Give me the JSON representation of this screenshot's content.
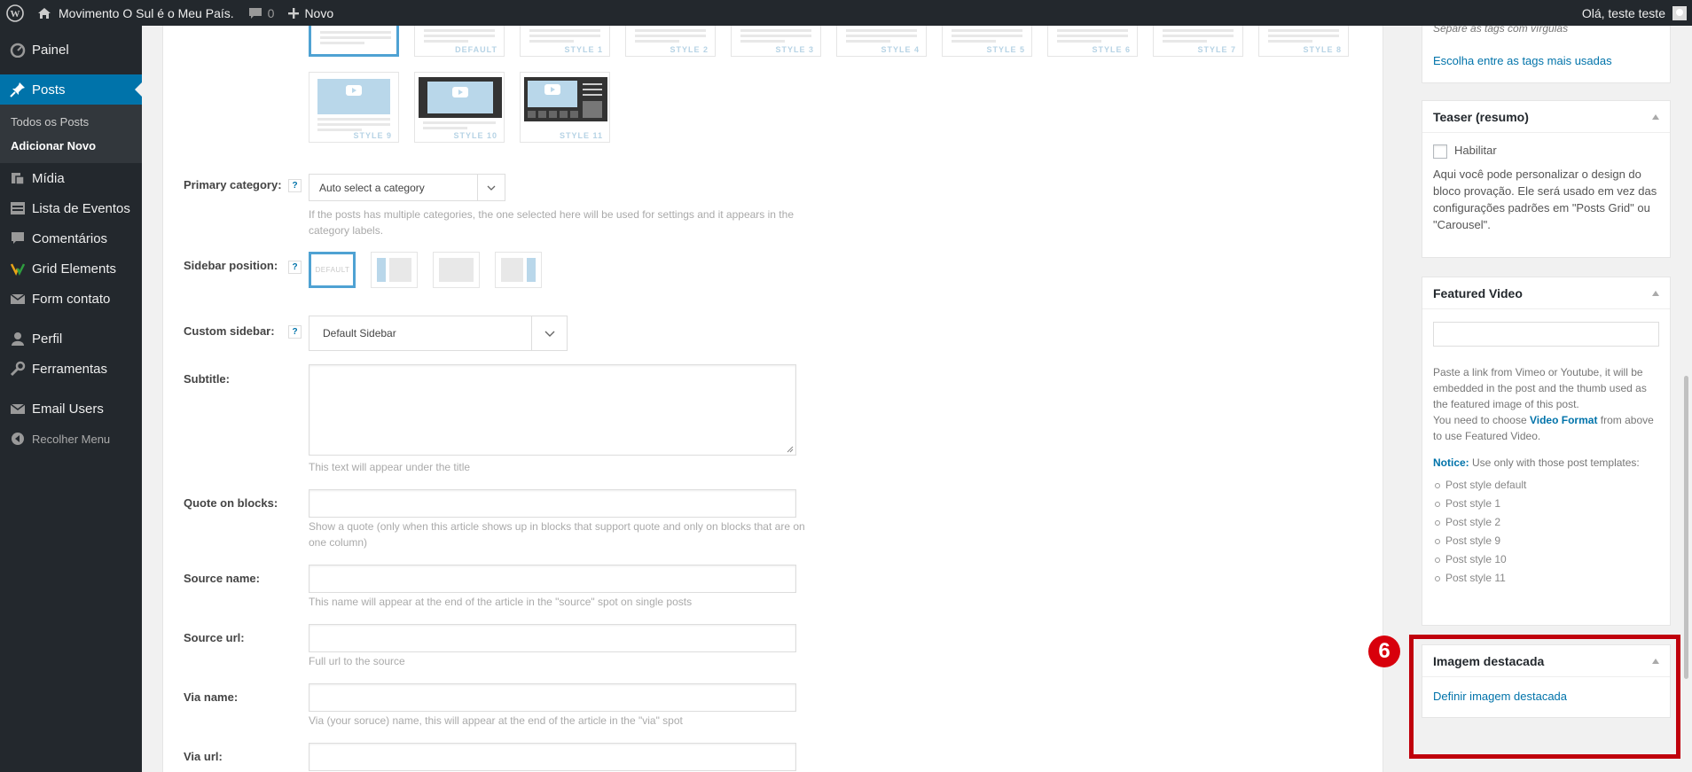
{
  "adminbar": {
    "site_name": "Movimento O Sul é o Meu País.",
    "comments_count": "0",
    "new_label": "Novo",
    "greeting": "Olá, teste teste"
  },
  "menu": {
    "painel": "Painel",
    "posts": "Posts",
    "sub_all": "Todos os Posts",
    "sub_new": "Adicionar Novo",
    "midia": "Mídia",
    "eventos": "Lista de Eventos",
    "comentarios": "Comentários",
    "grid": "Grid Elements",
    "form": "Form contato",
    "perfil": "Perfil",
    "ferramentas": "Ferramentas",
    "email": "Email Users",
    "recolher": "Recolher Menu"
  },
  "styles": {
    "row1": [
      "",
      "DEFAULT",
      "STYLE 1",
      "STYLE 2",
      "STYLE 3",
      "STYLE 4",
      "STYLE 5",
      "STYLE 6",
      "STYLE 7",
      "STYLE 8"
    ],
    "row2": [
      "STYLE 9",
      "STYLE 10",
      "STYLE 11"
    ]
  },
  "fields": {
    "primary_category": {
      "label": "Primary category:",
      "help": "?",
      "value": "Auto select a category",
      "desc": "If the posts has multiple categories, the one selected here will be used for settings and it appears in the category labels."
    },
    "sidebar_position": {
      "label": "Sidebar position:",
      "help": "?",
      "default_label": "DEFAULT"
    },
    "custom_sidebar": {
      "label": "Custom sidebar:",
      "help": "?",
      "value": "Default Sidebar"
    },
    "subtitle": {
      "label": "Subtitle:",
      "desc": "This text will appear under the title"
    },
    "quote": {
      "label": "Quote on blocks:",
      "desc": "Show a quote (only when this article shows up in blocks that support quote and only on blocks that are on one column)"
    },
    "source_name": {
      "label": "Source name:",
      "desc": "This name will appear at the end of the article in the \"source\" spot on single posts"
    },
    "source_url": {
      "label": "Source url:",
      "desc": "Full url to the source"
    },
    "via_name": {
      "label": "Via name:",
      "desc": "Via (your soruce) name, this will appear at the end of the article in the \"via\" spot"
    },
    "via_url": {
      "label": "Via url:"
    }
  },
  "tags_box": {
    "hint": "Separe as tags com vírgulas",
    "link": "Escolha entre as tags mais usadas"
  },
  "teaser_box": {
    "title": "Teaser (resumo)",
    "checkbox_label": "Habilitar",
    "text": "Aqui você pode personalizar o design do bloco provação. Ele será usado em vez das configurações padrões em \"Posts Grid\" ou \"Carousel\"."
  },
  "featured_video_box": {
    "title": "Featured Video",
    "text1": "Paste a link from Vimeo or Youtube, it will be embedded in the post and the thumb used as the featured image of this post.",
    "text2_pre": "You need to choose ",
    "text2_link": "Video Format",
    "text2_post": " from above to use Featured Video.",
    "notice_label": "Notice:",
    "notice_text": " Use only with those post templates:",
    "templates": [
      "Post style default",
      "Post style 1",
      "Post style 2",
      "Post style 9",
      "Post style 10",
      "Post style 11"
    ]
  },
  "featured_image_box": {
    "title": "Imagem destacada",
    "link": "Definir imagem destacada"
  },
  "step_badge": "6",
  "colors": {
    "adminbar": "#23282d",
    "menu_active": "#0073aa",
    "highlight": "#c0000c",
    "link": "#0073aa"
  }
}
